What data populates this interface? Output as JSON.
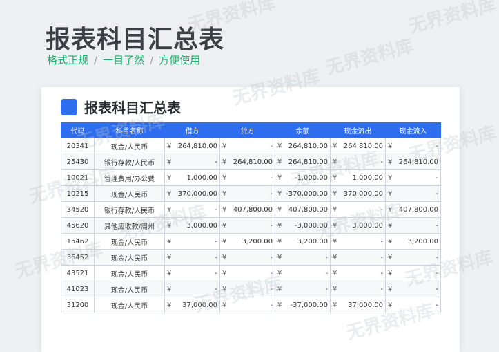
{
  "page": {
    "title": "报表科目汇总表",
    "tagline": [
      "格式正规",
      "一目了然",
      "方便使用"
    ],
    "separator": "/"
  },
  "card": {
    "title": "报表科目汇总表"
  },
  "table": {
    "currency_symbol": "¥",
    "headers": [
      "代码",
      "科目名称",
      "借方",
      "贷方",
      "余额",
      "现金流出",
      "现金流入"
    ],
    "rows": [
      [
        "20341",
        "现金/人民币",
        "264,810.00",
        "-",
        "264,810.00",
        "264,810.00",
        "-"
      ],
      [
        "25430",
        "银行存款/人民币",
        "-",
        "264,810.00",
        "264,810.00",
        "-",
        "264,810.00"
      ],
      [
        "10021",
        "管理费用/办公费",
        "1,000.00",
        "-",
        "-1,000.00",
        "1,000.00",
        "-"
      ],
      [
        "10215",
        "现金/人民币",
        "370,000.00",
        "-",
        "-370,000.00",
        "370,000.00",
        "-"
      ],
      [
        "34520",
        "银行存款/人民币",
        "-",
        "407,800.00",
        "407,800.00",
        "-",
        "407,800.00"
      ],
      [
        "45620",
        "其他应收款/周州",
        "3,000.00",
        "-",
        "-3,000.00",
        "3,000.00",
        "-"
      ],
      [
        "15462",
        "现金/人民币",
        "-",
        "3,200.00",
        "3,200.00",
        "-",
        "3,200.00"
      ],
      [
        "36452",
        "现金/人民币",
        "-",
        "-",
        "-",
        "-",
        "-"
      ],
      [
        "43521",
        "现金/人民币",
        "-",
        "-",
        "-",
        "-",
        "-"
      ],
      [
        "41023",
        "现金/人民币",
        "-",
        "-",
        "-",
        "-",
        "-"
      ],
      [
        "31200",
        "现金/人民币",
        "37,000.00",
        "-",
        "-37,000.00",
        "37,000.00",
        "-"
      ]
    ]
  },
  "watermark": {
    "text": "无界资料库"
  }
}
